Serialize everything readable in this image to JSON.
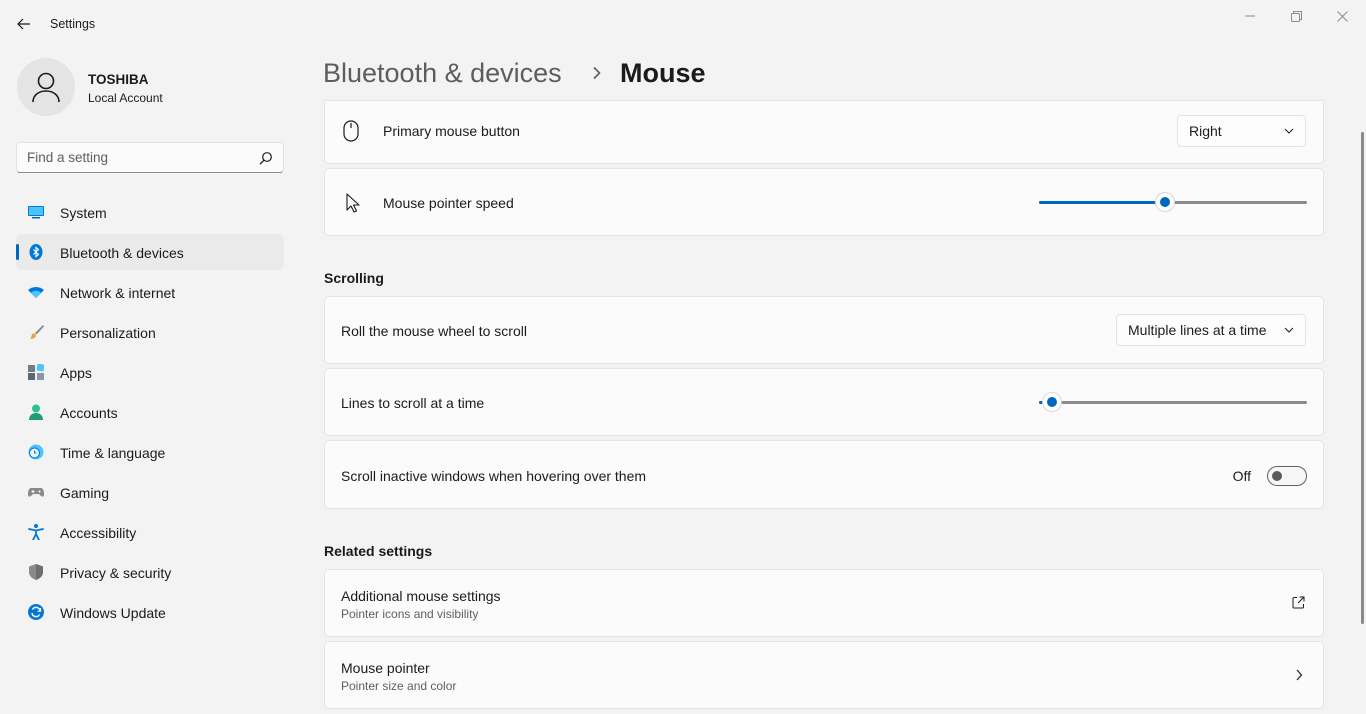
{
  "window": {
    "title": "Settings",
    "icons": {
      "back": "back-arrow-icon",
      "minimize": "minimize-icon",
      "restore": "restore-icon",
      "close": "close-icon"
    }
  },
  "account": {
    "name": "TOSHIBA",
    "type": "Local Account",
    "icon": "user-avatar-icon"
  },
  "search": {
    "placeholder": "Find a setting",
    "value": "",
    "icon": "search-icon"
  },
  "sidebar": {
    "items": [
      {
        "label": "System",
        "icon": "system-icon",
        "active": false
      },
      {
        "label": "Bluetooth & devices",
        "icon": "bluetooth-icon",
        "active": true
      },
      {
        "label": "Network & internet",
        "icon": "wifi-icon",
        "active": false
      },
      {
        "label": "Personalization",
        "icon": "brush-icon",
        "active": false
      },
      {
        "label": "Apps",
        "icon": "apps-icon",
        "active": false
      },
      {
        "label": "Accounts",
        "icon": "person-icon",
        "active": false
      },
      {
        "label": "Time & language",
        "icon": "globe-clock-icon",
        "active": false
      },
      {
        "label": "Gaming",
        "icon": "gamepad-icon",
        "active": false
      },
      {
        "label": "Accessibility",
        "icon": "accessibility-icon",
        "active": false
      },
      {
        "label": "Privacy & security",
        "icon": "shield-icon",
        "active": false
      },
      {
        "label": "Windows Update",
        "icon": "update-icon",
        "active": false
      }
    ],
    "accent_color": "#0067c0"
  },
  "header": {
    "parent": "Bluetooth & devices",
    "separator": "›",
    "current": "Mouse"
  },
  "main": {
    "primary_button": {
      "label": "Primary mouse button",
      "value": "Right",
      "icon": "mouse-icon"
    },
    "pointer_speed": {
      "label": "Mouse pointer speed",
      "value_fraction": 0.47,
      "icon": "pointer-icon"
    },
    "scrolling": {
      "title": "Scrolling",
      "roll_wheel": {
        "label": "Roll the mouse wheel to scroll",
        "value": "Multiple lines at a time"
      },
      "lines_to_scroll": {
        "label": "Lines to scroll at a time",
        "value_fraction": 0.05
      },
      "inactive_windows": {
        "label": "Scroll inactive windows when hovering over them",
        "state": "Off"
      }
    },
    "related": {
      "title": "Related settings",
      "additional": {
        "label": "Additional mouse settings",
        "sublabel": "Pointer icons and visibility",
        "icon": "open-external-icon"
      },
      "pointer": {
        "label": "Mouse pointer",
        "sublabel": "Pointer size and color",
        "icon": "chevron-right-icon"
      }
    }
  }
}
